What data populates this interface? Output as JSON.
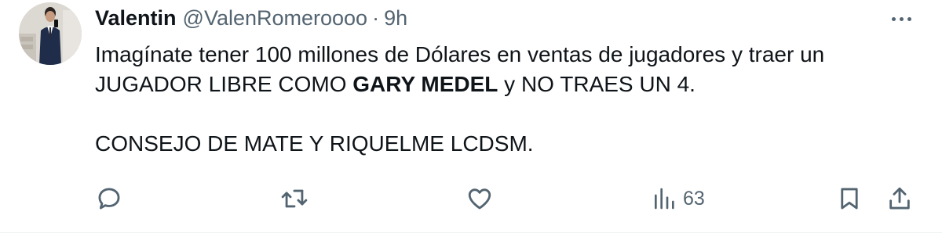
{
  "author": {
    "name": "Valentin",
    "handle": "@ValenRomeroooo",
    "separator": "·",
    "time": "9h"
  },
  "tweet": {
    "line1": "Imagínate tener 100 millones de Dólares en ventas de jugadores y traer un",
    "line2_before": "JUGADOR LIBRE COMO ",
    "line2_bold": "GARY MEDEL",
    "line2_after": " y NO TRAES UN 4.",
    "line3": "CONSEJO DE MATE Y RIQUELME LCDSM."
  },
  "actions": {
    "views_count": "63"
  },
  "icons": {
    "reply": "reply-icon",
    "retweet": "retweet-icon",
    "like": "like-icon",
    "views": "views-icon",
    "bookmark": "bookmark-icon",
    "share": "share-icon",
    "more": "more-icon"
  },
  "colors": {
    "text": "#0f1419",
    "secondary": "#536471"
  }
}
